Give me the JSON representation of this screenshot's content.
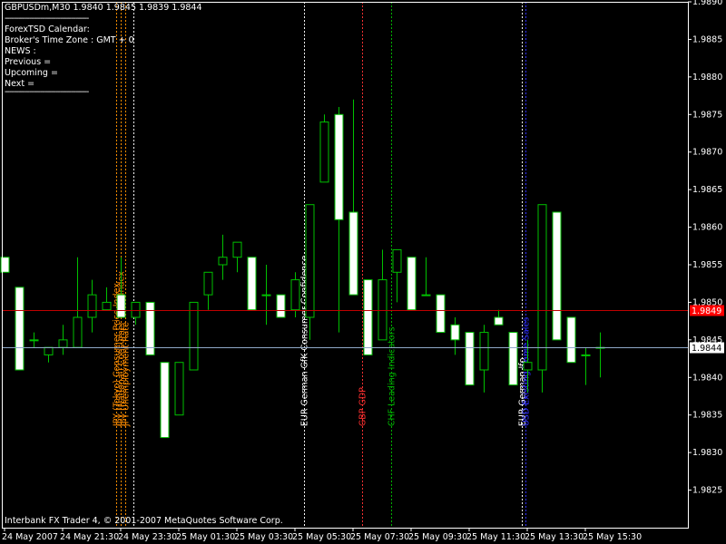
{
  "header": {
    "title": "GBPUSDm,M30  1.9840 1.9845 1.9839 1.9844"
  },
  "calendar_panel": {
    "separator": "--------------------------------------",
    "lines": [
      "ForexTSD Calendar:",
      "Broker's Time Zone : GMT + 0",
      "NEWS :",
      "Previous =",
      "Upcoming =",
      "Next ="
    ]
  },
  "footer": {
    "copyright": "Interbank FX Trader 4, © 2001-2007 MetaQuotes Software Corp."
  },
  "colors": {
    "background": "#000000",
    "grid": "#ffffff",
    "bull_candle": "#000000",
    "bear_candle": "#ffffff",
    "wick": "#00c000",
    "ask_line": "#c00000",
    "bid_line": "#8fa8c8",
    "ask_label_bg": "#ff0000",
    "bid_label_bg": "#ffffff"
  },
  "chart_data": {
    "type": "candlestick",
    "symbol": "GBPUSDm",
    "timeframe": "M30",
    "ylim": [
      1.982,
      1.989
    ],
    "y_ticks": [
      1.9825,
      1.983,
      1.9835,
      1.984,
      1.9845,
      1.985,
      1.9855,
      1.986,
      1.9865,
      1.987,
      1.9875,
      1.988,
      1.9885,
      1.989
    ],
    "y_tick_labels": [
      "1.9825",
      "1.9830",
      "1.9835",
      "1.9840",
      "1.9845",
      "1.9850",
      "1.9855",
      "1.9860",
      "1.9865",
      "1.9870",
      "1.9875",
      "1.9880",
      "1.9885",
      "1.9890"
    ],
    "x_tick_labels": [
      {
        "bar": 0,
        "label": "24 May 2007"
      },
      {
        "bar": 4,
        "label": "24 May 21:30"
      },
      {
        "bar": 8,
        "label": "24 May 23:30"
      },
      {
        "bar": 12,
        "label": "25 May 01:30"
      },
      {
        "bar": 16,
        "label": "25 May 03:30"
      },
      {
        "bar": 20,
        "label": "25 May 05:30"
      },
      {
        "bar": 24,
        "label": "25 May 07:30"
      },
      {
        "bar": 28,
        "label": "25 May 09:30"
      },
      {
        "bar": 32,
        "label": "25 May 11:30"
      },
      {
        "bar": 36,
        "label": "25 May 13:30"
      },
      {
        "bar": 40,
        "label": "25 May 15:30"
      }
    ],
    "candles": [
      {
        "o": 1.9856,
        "h": 1.9856,
        "l": 1.9854,
        "c": 1.9854
      },
      {
        "o": 1.9852,
        "h": 1.9852,
        "l": 1.9841,
        "c": 1.9841
      },
      {
        "o": 1.9845,
        "h": 1.9846,
        "l": 1.9844,
        "c": 1.9845
      },
      {
        "o": 1.9843,
        "h": 1.9844,
        "l": 1.9842,
        "c": 1.9844
      },
      {
        "o": 1.9844,
        "h": 1.9847,
        "l": 1.9843,
        "c": 1.9845
      },
      {
        "o": 1.9844,
        "h": 1.9856,
        "l": 1.9844,
        "c": 1.9848
      },
      {
        "o": 1.9848,
        "h": 1.9853,
        "l": 1.9846,
        "c": 1.9851
      },
      {
        "o": 1.9849,
        "h": 1.9852,
        "l": 1.9849,
        "c": 1.985
      },
      {
        "o": 1.9851,
        "h": 1.9856,
        "l": 1.9848,
        "c": 1.9848
      },
      {
        "o": 1.9848,
        "h": 1.985,
        "l": 1.9847,
        "c": 1.985
      },
      {
        "o": 1.985,
        "h": 1.985,
        "l": 1.9843,
        "c": 1.9843
      },
      {
        "o": 1.9842,
        "h": 1.9842,
        "l": 1.9832,
        "c": 1.9832
      },
      {
        "o": 1.9835,
        "h": 1.9842,
        "l": 1.9835,
        "c": 1.9842
      },
      {
        "o": 1.9841,
        "h": 1.985,
        "l": 1.9841,
        "c": 1.985
      },
      {
        "o": 1.9851,
        "h": 1.9854,
        "l": 1.9849,
        "c": 1.9854
      },
      {
        "o": 1.9855,
        "h": 1.9859,
        "l": 1.9853,
        "c": 1.9856
      },
      {
        "o": 1.9856,
        "h": 1.9858,
        "l": 1.9854,
        "c": 1.9858
      },
      {
        "o": 1.9856,
        "h": 1.9856,
        "l": 1.9849,
        "c": 1.9849
      },
      {
        "o": 1.9851,
        "h": 1.9855,
        "l": 1.9847,
        "c": 1.9851
      },
      {
        "o": 1.9851,
        "h": 1.9851,
        "l": 1.9848,
        "c": 1.9848
      },
      {
        "o": 1.9849,
        "h": 1.9854,
        "l": 1.9848,
        "c": 1.9853
      },
      {
        "o": 1.9848,
        "h": 1.9863,
        "l": 1.9845,
        "c": 1.9863
      },
      {
        "o": 1.9866,
        "h": 1.9875,
        "l": 1.9866,
        "c": 1.9874
      },
      {
        "o": 1.9875,
        "h": 1.9876,
        "l": 1.9846,
        "c": 1.9861
      },
      {
        "o": 1.9862,
        "h": 1.9877,
        "l": 1.9851,
        "c": 1.9851
      },
      {
        "o": 1.9853,
        "h": 1.9853,
        "l": 1.9843,
        "c": 1.9843
      },
      {
        "o": 1.9845,
        "h": 1.9857,
        "l": 1.9845,
        "c": 1.9853
      },
      {
        "o": 1.9854,
        "h": 1.9857,
        "l": 1.985,
        "c": 1.9857
      },
      {
        "o": 1.9856,
        "h": 1.9856,
        "l": 1.9849,
        "c": 1.9849
      },
      {
        "o": 1.9851,
        "h": 1.9856,
        "l": 1.9851,
        "c": 1.9851
      },
      {
        "o": 1.9851,
        "h": 1.9851,
        "l": 1.9846,
        "c": 1.9846
      },
      {
        "o": 1.9847,
        "h": 1.9848,
        "l": 1.9843,
        "c": 1.9845
      },
      {
        "o": 1.9846,
        "h": 1.9846,
        "l": 1.9839,
        "c": 1.9839
      },
      {
        "o": 1.9841,
        "h": 1.9847,
        "l": 1.9838,
        "c": 1.9846
      },
      {
        "o": 1.9848,
        "h": 1.9849,
        "l": 1.9847,
        "c": 1.9847
      },
      {
        "o": 1.9846,
        "h": 1.9846,
        "l": 1.9839,
        "c": 1.9839
      },
      {
        "o": 1.9841,
        "h": 1.9845,
        "l": 1.9838,
        "c": 1.9842
      },
      {
        "o": 1.9841,
        "h": 1.9863,
        "l": 1.9838,
        "c": 1.9863
      },
      {
        "o": 1.9862,
        "h": 1.9862,
        "l": 1.9845,
        "c": 1.9845
      },
      {
        "o": 1.9848,
        "h": 1.9848,
        "l": 1.9842,
        "c": 1.9842
      },
      {
        "o": 1.9843,
        "h": 1.9844,
        "l": 1.9839,
        "c": 1.9843
      },
      {
        "o": 1.9844,
        "h": 1.9846,
        "l": 1.984,
        "c": 1.9844
      }
    ],
    "price_lines": [
      {
        "name": "ask",
        "value": 1.9849,
        "label": "1.9849"
      },
      {
        "name": "bid",
        "value": 1.9844,
        "label": "1.9844"
      }
    ],
    "events": [
      {
        "bar": 7.7,
        "color": "#ff8c00",
        "text": "JPY (Tokyo) Consumer Price Index"
      },
      {
        "bar": 8.0,
        "color": "#ff8c00",
        "text": "JPY (National) Consumer Price Index"
      },
      {
        "bar": 8.3,
        "color": "#ff8c00",
        "text": "JPY Unemployment Rate"
      },
      {
        "bar": 8.9,
        "color": "#ffffff",
        "text": ""
      },
      {
        "bar": 20.6,
        "color": "#ffffff",
        "text": "EUR German GfK Consumer Confidence"
      },
      {
        "bar": 24.6,
        "color": "#ff3030",
        "text": "GBP GDP"
      },
      {
        "bar": 26.6,
        "color": "#00b000",
        "text": "CHF Leading Indicators"
      },
      {
        "bar": 35.6,
        "color": "#ffffff",
        "text": "EUR German Ifo"
      },
      {
        "bar": 35.9,
        "color": "#3030ff",
        "text": "USD Existing Home Sales"
      }
    ]
  }
}
